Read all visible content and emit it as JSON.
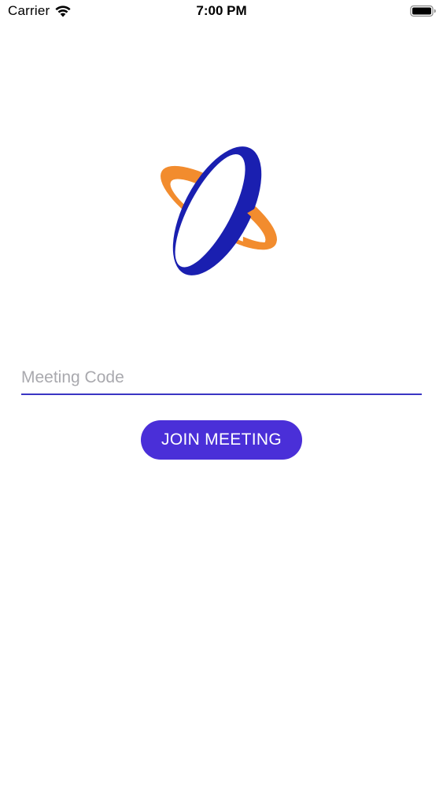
{
  "status_bar": {
    "carrier": "Carrier",
    "time": "7:00 PM",
    "wifi_icon": "wifi-icon",
    "battery_icon": "battery-full-icon"
  },
  "logo": {
    "icon": "orbit-logo-icon",
    "colors": {
      "orange": "#f28c2e",
      "blue": "#1a1fb0"
    }
  },
  "form": {
    "meeting_code": {
      "placeholder": "Meeting Code",
      "value": ""
    },
    "join_button_label": "JOIN MEETING"
  },
  "theme": {
    "accent": "#4a2fd8",
    "underline": "#3a35c4",
    "background": "#ffffff"
  }
}
